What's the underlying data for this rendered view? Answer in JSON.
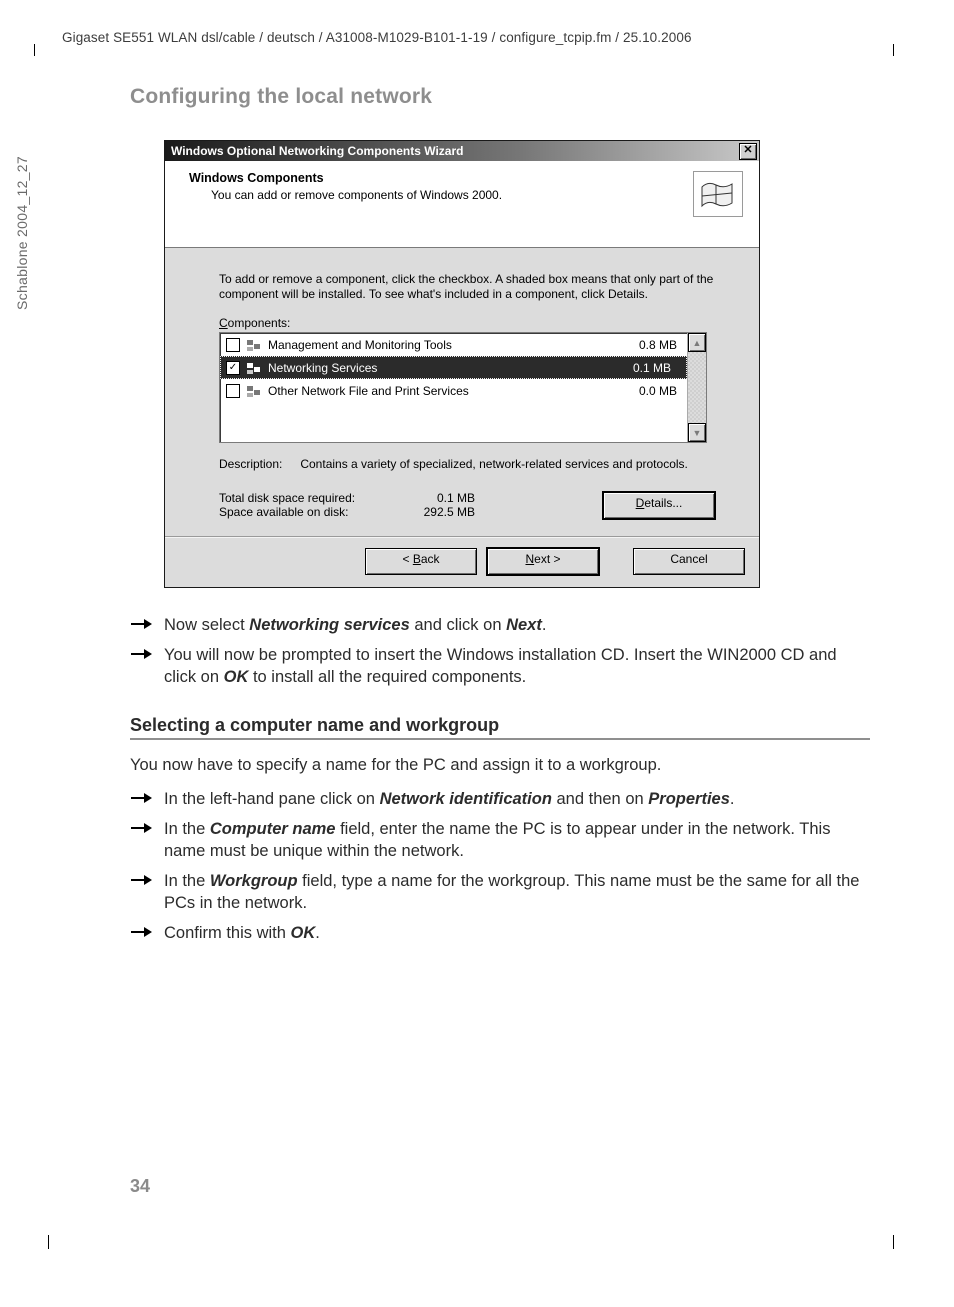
{
  "header": "Gigaset SE551 WLAN dsl/cable / deutsch / A31008-M1029-B101-1-19 / configure_tcpip.fm / 25.10.2006",
  "side_text": "Schablone 2004_12_27",
  "page_title": "Configuring the local network",
  "page_number": "34",
  "wizard": {
    "title": "Windows Optional Networking Components Wizard",
    "close": "✕",
    "heading": "Windows Components",
    "subheading": "You can add or remove components of Windows 2000.",
    "help": "To add or remove a component, click the checkbox.  A shaded box means that only part of the component will be installed.  To see what's included in a component, click Details.",
    "components_label_prefix": "C",
    "components_label_rest": "omponents:",
    "items": [
      {
        "checked": false,
        "name": "Management and Monitoring Tools",
        "size": "0.8 MB"
      },
      {
        "checked": true,
        "name": "Networking Services",
        "size": "0.1 MB"
      },
      {
        "checked": false,
        "name": "Other Network File and Print Services",
        "size": "0.0 MB"
      }
    ],
    "description_label": "Description:",
    "description": "Contains a variety of specialized, network-related services and protocols.",
    "total_label": "Total disk space required:",
    "total_value": "0.1 MB",
    "avail_label": "Space available on disk:",
    "avail_value": "292.5 MB",
    "details_btn_pre": "D",
    "details_btn_rest": "etails...",
    "back_pre": "< ",
    "back_u": "B",
    "back_rest": "ack",
    "next_u": "N",
    "next_rest": "ext >",
    "cancel": "Cancel"
  },
  "doc": {
    "step1_a": "Now select ",
    "step1_b": "Networking services",
    "step1_c": " and click on ",
    "step1_d": "Next",
    "step1_e": ".",
    "step2_a": "You will now be prompted to insert the Windows installation CD. Insert the WIN2000 CD and click on ",
    "step2_b": "OK",
    "step2_c": " to install all the required components.",
    "h2": "Selecting a computer name and workgroup",
    "para": "You now have to specify a name for the PC and assign it to a workgroup.",
    "s3_a": "In the left-hand pane click on ",
    "s3_b": "Network identification",
    "s3_c": " and then on ",
    "s3_d": "Properties",
    "s3_e": ".",
    "s4_a": "In the ",
    "s4_b": "Computer name",
    "s4_c": " field, enter the name the PC is to appear under in the net­work. This name must be unique within the network.",
    "s5_a": "In the ",
    "s5_b": "Workgroup",
    "s5_c": " field, type a name for the workgroup. This name must be the same for all the PCs in the network.",
    "s6_a": "Confirm this with ",
    "s6_b": "OK",
    "s6_c": "."
  }
}
